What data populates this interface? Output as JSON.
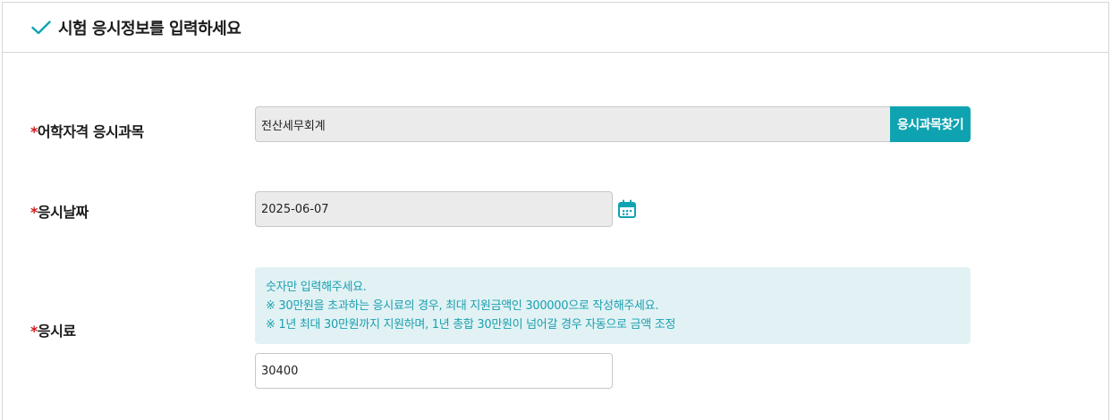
{
  "section": {
    "title": "시험 응시정보를 입력하세요"
  },
  "fields": {
    "subject": {
      "required_mark": "*",
      "label": "어학자격 응시과목",
      "value": "전산세무회계",
      "button_label": "응시과목찾기"
    },
    "date": {
      "required_mark": "*",
      "label": "응시날짜",
      "value": "2025-06-07"
    },
    "fee": {
      "required_mark": "*",
      "label": "응시료",
      "notice": [
        "숫자만 입력해주세요.",
        "※ 30만원을 초과하는 응시료의 경우, 최대 지원금액인 300000으로 작성해주세요.",
        "※ 1년 최대 30만원까지 지원하며, 1년 총합 30만원이 넘어갈 경우 자동으로 금액 조정"
      ],
      "value": "30400"
    }
  },
  "colors": {
    "accent": "#0fa3b1",
    "required": "#d21a1a",
    "notice_bg": "#e2f2f4",
    "readonly_bg": "#ebebeb"
  },
  "icons": {
    "header": "check-icon",
    "date": "calendar-icon"
  }
}
